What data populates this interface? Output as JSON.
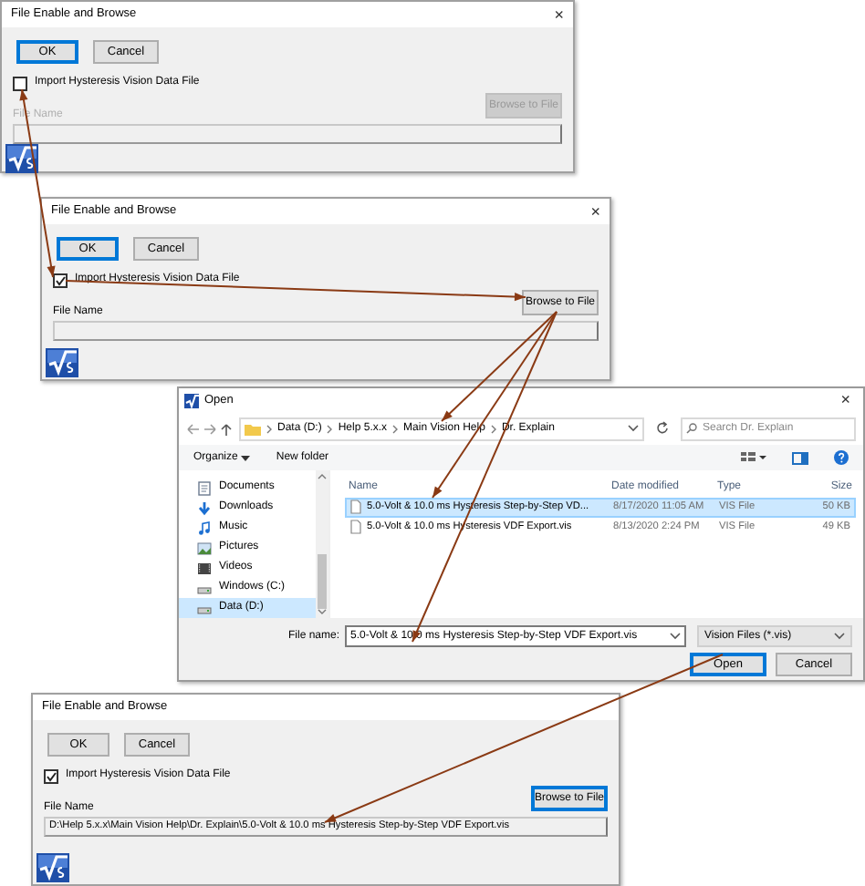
{
  "dialogs": [
    {
      "title": "File Enable and Browse",
      "close": "×",
      "buttons": [
        {
          "label": "OK",
          "focused": true
        },
        {
          "label": "Cancel",
          "focused": false
        }
      ],
      "checkbox": {
        "label": "Import Hysteresis Vision Data File",
        "checked": false
      },
      "browse_button": {
        "label": "Browse to File",
        "focused": false
      },
      "controls_disabled": true,
      "file_name_label": "File Name"
    },
    {
      "title": "File Enable and Browse",
      "close": "×",
      "buttons": [
        {
          "label": "OK",
          "focused": true
        },
        {
          "label": "Cancel",
          "focused": false
        }
      ],
      "checkbox": {
        "label": "Import Hysteresis Vision Data File",
        "checked": true
      },
      "browse_button": {
        "label": "Browse to File",
        "focused": false
      },
      "controls_disabled": false,
      "file_name_label": "File Name"
    },
    {
      "title": "File Enable and Browse",
      "buttons": [
        {
          "label": "OK",
          "focused": false
        },
        {
          "label": "Cancel",
          "focused": false
        }
      ],
      "checkbox": {
        "label": "Import Hysteresis Vision Data File",
        "checked": true
      },
      "browse_button": {
        "label": "Browse to File",
        "focused": true
      },
      "controls_disabled": false,
      "file_name_label": "File Name",
      "file_name_value": "D:\\Help 5.x.x\\Main Vision Help\\Dr. Explain\\5.0-Volt & 10.0 ms Hysteresis Step-by-Step VDF Export.vis"
    }
  ],
  "open_dialog": {
    "title": "Open",
    "close": "×",
    "path": [
      "Data (D:)",
      "Help 5.x.x",
      "Main Vision Help",
      "Dr. Explain"
    ],
    "search": {
      "placeholder": "Search Dr. Explain"
    },
    "toolbar": [
      {
        "label": "Organize",
        "kind": "menu"
      },
      {
        "label": "New folder",
        "kind": "button"
      }
    ],
    "nav_items": [
      {
        "label": "Documents",
        "kind": "documents",
        "selected": false
      },
      {
        "label": "Downloads",
        "kind": "downloads",
        "selected": false
      },
      {
        "label": "Music",
        "kind": "music",
        "selected": false
      },
      {
        "label": "Pictures",
        "kind": "pictures",
        "selected": false
      },
      {
        "label": "Videos",
        "kind": "videos",
        "selected": false
      },
      {
        "label": "Windows (C:)",
        "kind": "drive",
        "selected": false
      },
      {
        "label": "Data (D:)",
        "kind": "drive",
        "selected": true
      }
    ],
    "columns": [
      "Name",
      "Date modified",
      "Type",
      "Size"
    ],
    "files": [
      {
        "cells": [
          "5.0-Volt & 10.0 ms Hysteresis Step-by-Step VD...",
          "8/17/2020 11:05 AM",
          "VIS File",
          "50 KB"
        ],
        "selected": true
      },
      {
        "cells": [
          "5.0-Volt & 10.0 ms Hysteresis VDF Export.vis",
          "8/13/2020 2:24 PM",
          "VIS File",
          "49 KB"
        ],
        "selected": false
      }
    ],
    "file_name": {
      "label": "File name:",
      "value": "5.0-Volt & 10.0 ms Hysteresis Step-by-Step VDF Export.vis"
    },
    "filter": "Vision Files (*.vis)",
    "buttons": [
      {
        "label": "Open",
        "focused": true
      },
      {
        "label": "Cancel",
        "focused": false
      }
    ]
  }
}
